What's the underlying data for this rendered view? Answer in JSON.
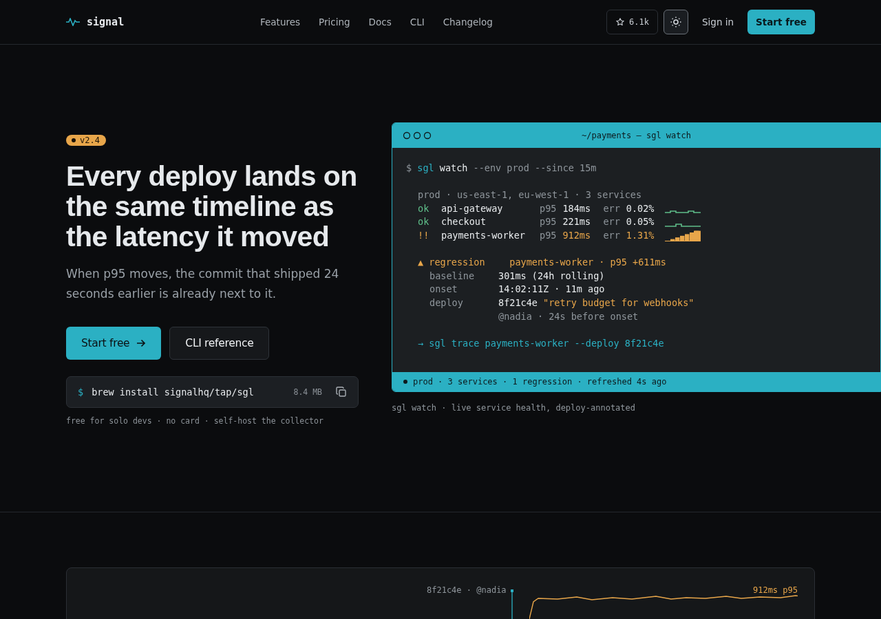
{
  "nav": {
    "brand": "signal",
    "links": [
      "Features",
      "Pricing",
      "Docs",
      "CLI",
      "Changelog"
    ],
    "stars": "6.1k",
    "sign_in": "Sign in",
    "cta": "Start free"
  },
  "hero": {
    "badge": "v2.4",
    "title": "Every deploy lands on the same timeline as the latency it moved",
    "subtitle": "When p95 moves, the commit that shipped 24 seconds earlier is already next to it.",
    "buttons": [
      {
        "label": "Start free",
        "kind": "primary"
      },
      {
        "label": "CLI reference",
        "kind": "secondary"
      }
    ],
    "install": {
      "prompt": "$",
      "command": "brew install signalhq/tap/sgl",
      "size": "8.4 MB"
    },
    "footnote": "free for solo devs · no card · self-host the collector"
  },
  "terminal": {
    "title": "~/payments — sgl watch",
    "prompt": "$",
    "bin": "sgl",
    "sub": "watch",
    "args": "--env prod --since 15m",
    "context": "prod · us-east-1, eu-west-1 · 3 services",
    "services": [
      {
        "status": "ok",
        "name": "api-gateway",
        "p95_label": "p95",
        "p95": "184ms",
        "err_label": "err",
        "err": "0.02%",
        "alert": false
      },
      {
        "status": "ok",
        "name": "checkout",
        "p95_label": "p95",
        "p95": "221ms",
        "err_label": "err",
        "err": "0.05%",
        "alert": false
      },
      {
        "status": "!!",
        "name": "payments-worker",
        "p95_label": "p95",
        "p95": "912ms",
        "err_label": "err",
        "err": "1.31%",
        "alert": true
      }
    ],
    "regression": {
      "icon": "▲",
      "label": "regression",
      "summary": "payments-worker · p95 +611ms"
    },
    "details": [
      {
        "key": "baseline",
        "value": "301ms (24h rolling)"
      },
      {
        "key": "onset",
        "value": "14:02:11Z · 11m ago"
      },
      {
        "key": "deploy",
        "value": "8f21c4e",
        "quote": "\"retry budget for webhooks\"",
        "note": "@nadia · 24s before onset"
      }
    ],
    "next": "→ sgl trace payments-worker --deploy 8f21c4e",
    "status_bar": "prod · 3 services · 1 regression · refreshed 4s ago"
  },
  "caption": "sgl watch · live service health, deploy-annotated",
  "timeline": {
    "marker": "8f21c4e · @nadia",
    "value": "912ms p95"
  }
}
